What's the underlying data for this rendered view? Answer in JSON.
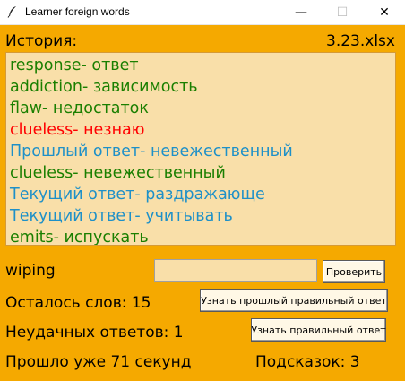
{
  "window": {
    "title": "Learner foreign words",
    "controls": {
      "minimize": "—",
      "maximize": "☐",
      "close": "✕"
    }
  },
  "header": {
    "history_label": "История:",
    "filename": "3.23.xlsx"
  },
  "history": [
    {
      "text": "response- ответ",
      "color": "#1a7f00"
    },
    {
      "text": "addiction- зависимость",
      "color": "#1a7f00"
    },
    {
      "text": "flaw- недостаток",
      "color": "#1a7f00"
    },
    {
      "text": "clueless- незнаю",
      "color": "#ff0000"
    },
    {
      "text": "Прошлый ответ- невежественный",
      "color": "#1e90c8"
    },
    {
      "text": "clueless- невежественный",
      "color": "#1a7f00"
    },
    {
      "text": "Текущий ответ- раздражающе",
      "color": "#1e90c8"
    },
    {
      "text": "Текущий ответ- учитывать",
      "color": "#1e90c8"
    },
    {
      "text": "emits- испускать",
      "color": "#1a7f00"
    }
  ],
  "quiz": {
    "current_word": "wiping",
    "answer_value": "",
    "check_button": "Проверить",
    "words_left": "Осталось слов: 15",
    "prev_answer_button": "Узнать прошлый правильный ответ",
    "failed_answers": "Неудачных ответов: 1",
    "show_answer_button": "Узнать правильный ответ",
    "elapsed": "Прошло уже 71 секунд",
    "hints": "Подсказок: 3"
  },
  "colors": {
    "background": "#f5a900",
    "panel": "#f9dfa9"
  }
}
